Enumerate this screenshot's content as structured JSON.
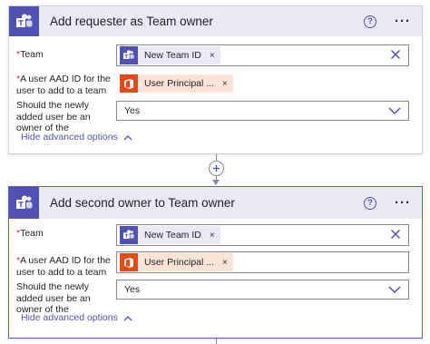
{
  "steps": [
    {
      "title": "Add requester as Team owner",
      "help_symbol": "?",
      "more_symbol": "···",
      "team_label": "Team",
      "team_token": "New Team ID",
      "user_label": "A user AAD ID for the user to add to a team",
      "user_token": "User Principal ...",
      "owner_label": "Should the newly added user be an owner of the",
      "owner_value": "Yes",
      "advanced_label": "Hide advanced options"
    },
    {
      "title": "Add second owner to Team owner",
      "help_symbol": "?",
      "more_symbol": "···",
      "team_label": "Team",
      "team_token": "New Team ID",
      "user_label": "A user AAD ID for the user to add to a team",
      "user_token": "User Principal ...",
      "owner_label": "Should the newly added user be an owner of the",
      "owner_value": "Yes",
      "advanced_label": "Hide advanced options"
    }
  ],
  "required_marker": "*",
  "token_remove_symbol": "×",
  "icons": {
    "app": "microsoft-teams-icon",
    "team_token": "microsoft-teams-icon",
    "user_token": "office-icon",
    "clear": "close-icon",
    "dropdown": "chevron-down-icon",
    "advanced": "chevron-up-icon",
    "add_step": "plus-icon"
  },
  "colors": {
    "teams_purple": "#4f52b2",
    "header_bg": "#e9eaf6",
    "office_orange": "#e64a19",
    "office_token_bg": "#fbe3d6",
    "required_red": "#c4314b"
  }
}
